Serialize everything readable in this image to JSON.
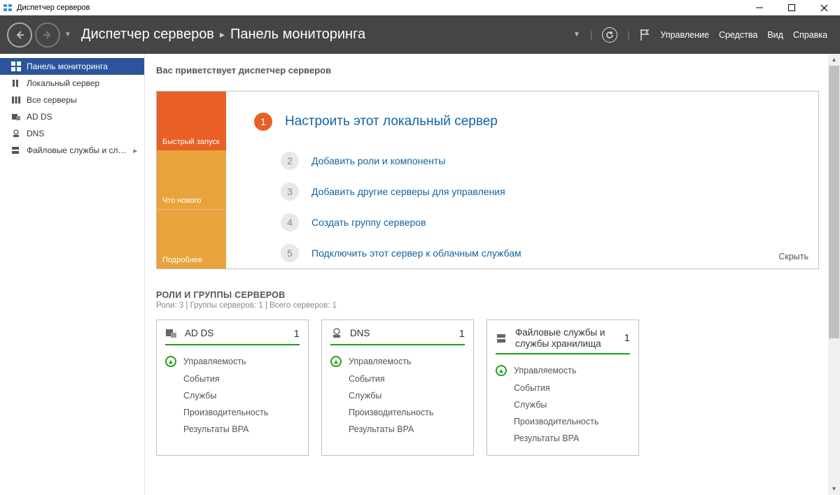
{
  "window": {
    "title": "Диспетчер серверов"
  },
  "header": {
    "crumb_root": "Диспетчер серверов",
    "crumb_page": "Панель мониторинга",
    "menu": {
      "manage": "Управление",
      "tools": "Средства",
      "view": "Вид",
      "help": "Справка"
    }
  },
  "sidebar": {
    "items": [
      {
        "label": "Панель мониторинга",
        "icon": "dashboard"
      },
      {
        "label": "Локальный сервер",
        "icon": "server"
      },
      {
        "label": "Все серверы",
        "icon": "servers"
      },
      {
        "label": "AD DS",
        "icon": "adds"
      },
      {
        "label": "DNS",
        "icon": "dns"
      },
      {
        "label": "Файловые службы и сл…",
        "icon": "files",
        "expandable": true
      }
    ]
  },
  "welcome": {
    "heading": "Вас приветствует диспетчер серверов",
    "tabs": {
      "quick": "Быстрый запуск",
      "whatsnew": "Что нового",
      "more": "Подробнее"
    },
    "steps": [
      "Настроить этот локальный сервер",
      "Добавить роли и компоненты",
      "Добавить другие серверы для управления",
      "Создать группу серверов",
      "Подключить этот сервер к облачным службам"
    ],
    "nums": [
      "1",
      "2",
      "3",
      "4",
      "5"
    ],
    "hide": "Скрыть"
  },
  "roles": {
    "section_title": "РОЛИ И ГРУППЫ СЕРВЕРОВ",
    "section_sub": "Роли: 3 | Группы серверов: 1 | Всего серверов: 1",
    "cards": [
      {
        "title": "AD DS",
        "count": "1"
      },
      {
        "title": "DNS",
        "count": "1"
      },
      {
        "title": "Файловые службы и службы хранилища",
        "count": "1"
      }
    ],
    "lines": {
      "manageability": "Управляемость",
      "events": "События",
      "services": "Службы",
      "performance": "Производительность",
      "bpa": "Результаты BPA"
    }
  }
}
